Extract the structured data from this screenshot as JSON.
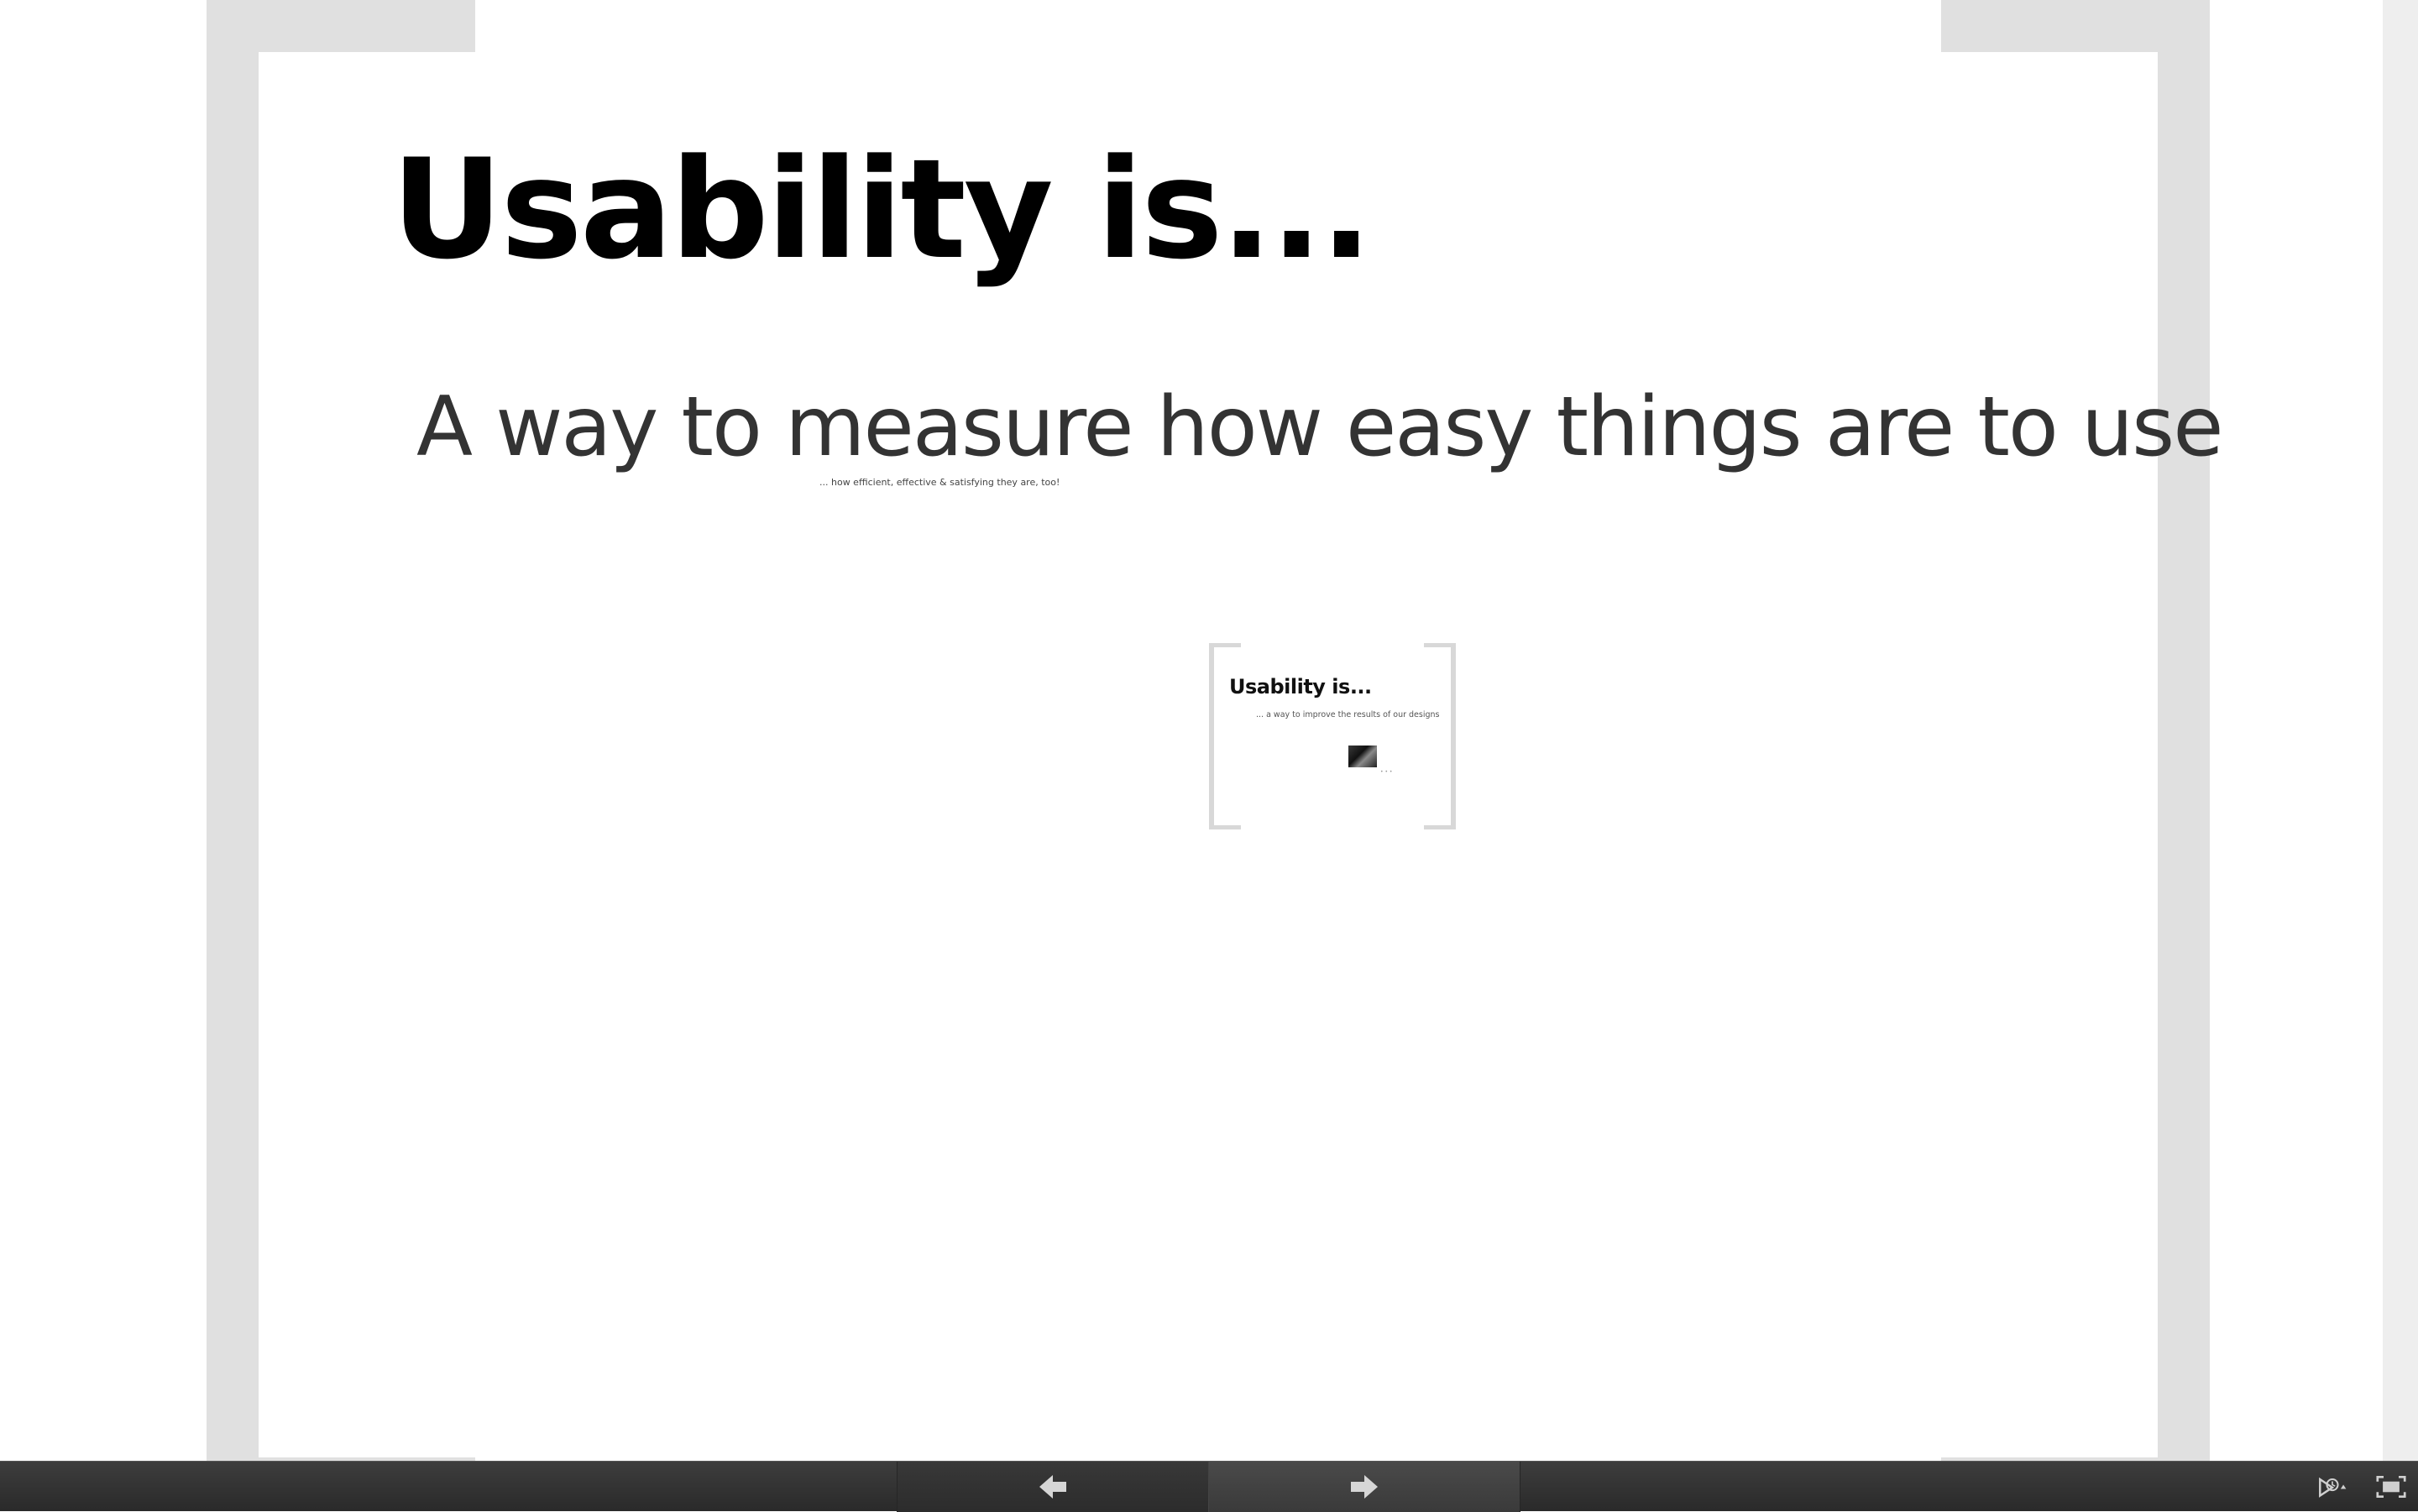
{
  "slide": {
    "title": "Usability is...",
    "subtitle": "A way to measure how easy things are to use",
    "note": "... how efficient, effective & satisfying they are, too!"
  },
  "mini_frame": {
    "title": "Usability is...",
    "subtitle": "... a way to improve the results of our designs",
    "dots": "• • •"
  },
  "toolbar": {
    "prev_icon": "arrow-left-icon",
    "next_icon": "arrow-right-icon",
    "autoplay_icon": "autoplay-icon",
    "fullscreen_icon": "fullscreen-icon"
  },
  "colors": {
    "bracket": "#e0e0e0",
    "toolbar": "#333333",
    "arrow": "#d0d0d0"
  }
}
